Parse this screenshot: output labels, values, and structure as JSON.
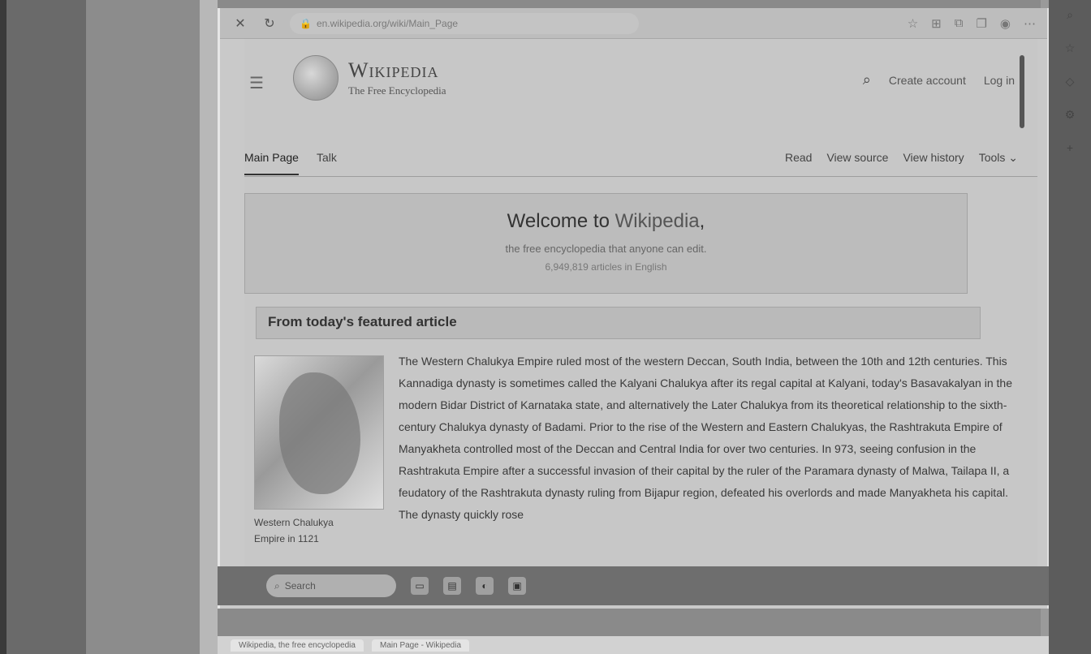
{
  "browser": {
    "url": "en.wikipedia.org/wiki/Main_Page"
  },
  "header": {
    "logo_title": "Wikipedia",
    "logo_tagline": "The Free Encyclopedia",
    "create_account": "Create account",
    "log_in": "Log in"
  },
  "tabs": {
    "main_page": "Main Page",
    "talk": "Talk",
    "read": "Read",
    "view_source": "View source",
    "view_history": "View history",
    "tools": "Tools"
  },
  "banner": {
    "welcome_prefix": "Welcome to ",
    "welcome_link": "Wikipedia",
    "welcome_suffix": ",",
    "subtitle": "the free encyclopedia that anyone can edit.",
    "article_count": "6,949,819 articles in English"
  },
  "featured": {
    "heading": "From today's featured article",
    "caption_line1": "Western Chalukya",
    "caption_line2": "Empire in 1121",
    "text": "The Western Chalukya Empire ruled most of the western Deccan, South India, between the 10th and 12th centuries. This Kannadiga dynasty is sometimes called the Kalyani Chalukya after its regal capital at Kalyani, today's Basavakalyan in the modern Bidar District of Karnataka state, and alternatively the Later Chalukya from its theoretical relationship to the sixth-century Chalukya dynasty of Badami. Prior to the rise of the Western and Eastern Chalukyas, the Rashtrakuta Empire of Manyakheta controlled most of the Deccan and Central India for over two centuries. In 973, seeing confusion in the Rashtrakuta Empire after a successful invasion of their capital by the ruler of the Paramara dynasty of Malwa, Tailapa II, a feudatory of the Rashtrakuta dynasty ruling from Bijapur region, defeated his overlords and made Manyakheta his capital. The dynasty quickly rose"
  },
  "taskbar": {
    "search_placeholder": "Search"
  },
  "bottom_tabs": [
    "Wikipedia, the free encyclopedia",
    "Main Page - Wikipedia"
  ]
}
